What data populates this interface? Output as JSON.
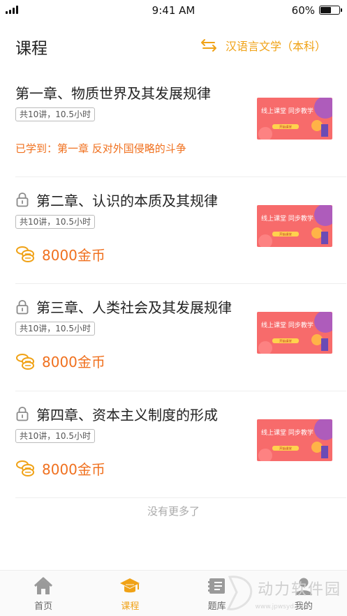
{
  "status_bar": {
    "time": "9:41 AM",
    "battery": "60%",
    "battery_level": 0.6
  },
  "header": {
    "title": "课程",
    "major": "汉语言文学（本科）"
  },
  "courses": [
    {
      "title": "第一章、物质世界及其发展规律",
      "meta": "共10讲，10.5小时",
      "locked": false,
      "progress": "已学到：第一章 反对外国侵略的斗争"
    },
    {
      "title": "第二章、认识的本质及其规律",
      "meta": "共10讲，10.5小时",
      "locked": true,
      "price": "8000金币"
    },
    {
      "title": "第三章、人类社会及其发展规律",
      "meta": "共10讲，10.5小时",
      "locked": true,
      "price": "8000金币"
    },
    {
      "title": "第四章、资本主义制度的形成",
      "meta": "共10讲，10.5小时",
      "locked": true,
      "price": "8000金币"
    }
  ],
  "thumbnail": {
    "headline": "线上课堂 同步教学",
    "button": "开始课堂"
  },
  "footer": {
    "no_more": "没有更多了"
  },
  "tabs": [
    {
      "label": "首页",
      "icon": "home-icon",
      "active": false
    },
    {
      "label": "课程",
      "icon": "graduation-cap-icon",
      "active": true
    },
    {
      "label": "题库",
      "icon": "question-bank-icon",
      "active": false
    },
    {
      "label": "我的",
      "icon": "user-icon",
      "active": false
    }
  ],
  "watermark": {
    "text": "动力软件园",
    "url": "www.jpwsyd.com"
  },
  "colors": {
    "accent": "#f0a216",
    "price": "#f0701e",
    "banner": "#f76b6b"
  }
}
